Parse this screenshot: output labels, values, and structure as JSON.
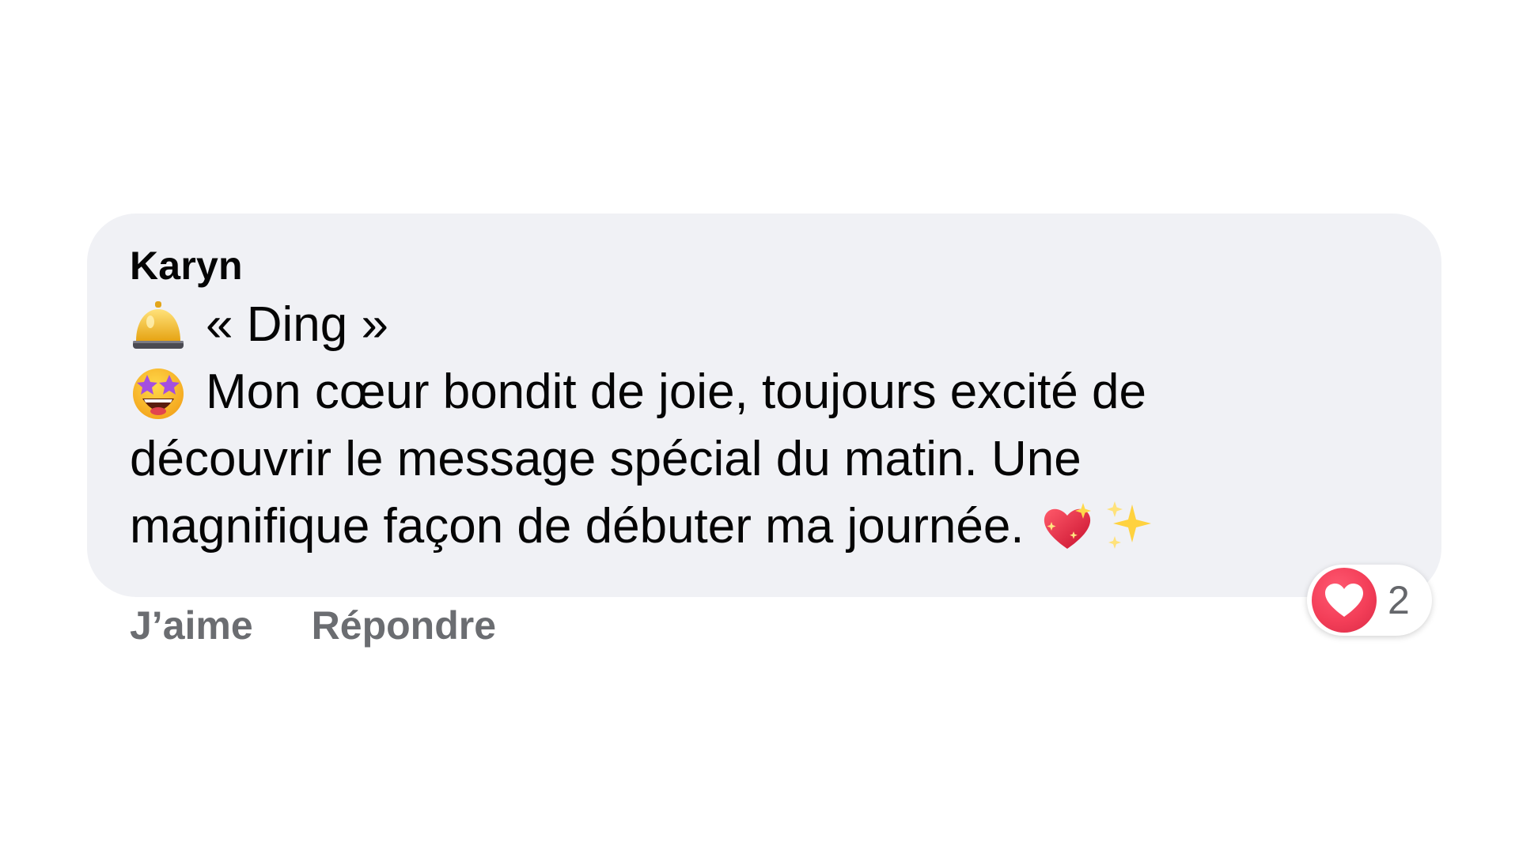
{
  "comment": {
    "author": "Karyn",
    "lines": [
      {
        "lead_icon": "bellhop-bell-icon",
        "text": "« Ding »"
      },
      {
        "lead_icon": "star-struck-face-icon",
        "text": "Mon cœur bondit de joie, toujours excité de"
      },
      {
        "text": "découvrir le message spécial du matin. Une"
      },
      {
        "text": "magnifique façon de débuter ma journée.",
        "trail_icons": [
          "sparkling-heart-icon",
          "sparkles-icon"
        ]
      }
    ]
  },
  "actions": {
    "like_label": "J’aime",
    "reply_label": "Répondre"
  },
  "reactions": {
    "icon": "heart-reaction-icon",
    "count": "2",
    "color": "#f33e58"
  },
  "colors": {
    "bubble": "#f0f1f5",
    "text": "#050505",
    "action_text": "#6b6d71"
  }
}
